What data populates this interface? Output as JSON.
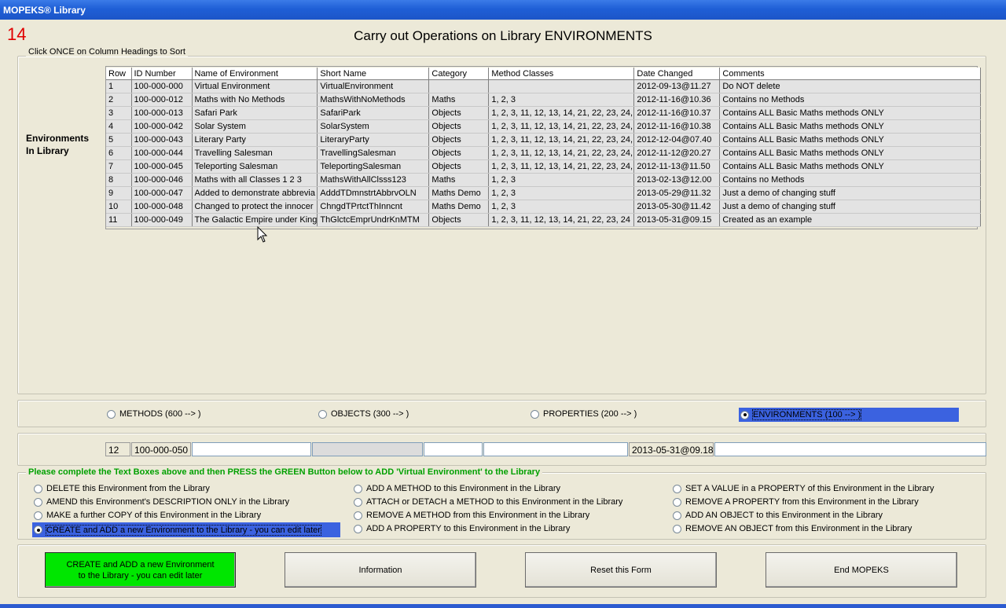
{
  "window": {
    "title": "MOPEKS® Library"
  },
  "page_number": "14",
  "heading": "Carry out Operations on Library ENVIRONMENTS",
  "table_group": {
    "legend": "Click ONCE on Column Headings to Sort",
    "side_label": [
      "Environments",
      "In Library"
    ]
  },
  "table": {
    "columns": [
      "Row",
      "ID Number",
      "Name of Environment",
      "Short Name",
      "Category",
      "Method Classes",
      "Date Changed",
      "Comments"
    ],
    "rows": [
      [
        "1",
        "100-000-000",
        "Virtual Environment",
        "VirtualEnvironment",
        "",
        "",
        "2012-09-13@11.27",
        "Do NOT delete"
      ],
      [
        "2",
        "100-000-012",
        "Maths with No Methods",
        "MathsWithNoMethods",
        "Maths",
        "1, 2, 3",
        "2012-11-16@10.36",
        "Contains no Methods"
      ],
      [
        "3",
        "100-000-013",
        "Safari Park",
        "SafariPark",
        "Objects",
        "1, 2, 3, 11, 12, 13, 14, 21, 22, 23, 24,",
        "2012-11-16@10.37",
        "Contains ALL Basic Maths methods ONLY"
      ],
      [
        "4",
        "100-000-042",
        "Solar System",
        "SolarSystem",
        "Objects",
        "1, 2, 3, 11, 12, 13, 14, 21, 22, 23, 24,",
        "2012-11-16@10.38",
        "Contains ALL Basic Maths methods ONLY"
      ],
      [
        "5",
        "100-000-043",
        "Literary Party",
        "LiteraryParty",
        "Objects",
        "1, 2, 3, 11, 12, 13, 14, 21, 22, 23, 24,",
        "2012-12-04@07.40",
        "Contains ALL Basic Maths methods ONLY"
      ],
      [
        "6",
        "100-000-044",
        "Travelling Salesman",
        "TravellingSalesman",
        "Objects",
        "1, 2, 3, 11, 12, 13, 14, 21, 22, 23, 24,",
        "2012-11-12@20.27",
        "Contains ALL Basic Maths methods ONLY"
      ],
      [
        "7",
        "100-000-045",
        "Teleporting Salesman",
        "TeleportingSalesman",
        "Objects",
        "1, 2, 3, 11, 12, 13, 14, 21, 22, 23, 24,",
        "2012-11-13@11.50",
        "Contains ALL Basic Maths methods ONLY"
      ],
      [
        "8",
        "100-000-046",
        "Maths with all Classes 1 2 3",
        "MathsWithAllClsss123",
        "Maths",
        "1, 2, 3",
        "2013-02-13@12.00",
        "Contains no Methods"
      ],
      [
        "9",
        "100-000-047",
        "Added to demonstrate abbrevia",
        "AdddTDmnstrtAbbrvOLN",
        "Maths Demo",
        "1, 2, 3",
        "2013-05-29@11.32",
        "Just a demo of changing stuff"
      ],
      [
        "10",
        "100-000-048",
        "Changed to protect the innocer",
        "ChngdTPrtctThInncnt",
        "Maths Demo",
        "1, 2, 3",
        "2013-05-30@11.42",
        "Just a demo of changing stuff"
      ],
      [
        "11",
        "100-000-049",
        "The Galactic Empire under King",
        "ThGlctcEmprUndrKnMTM",
        "Objects",
        "1, 2, 3, 11, 12, 13, 14, 21, 22, 23, 24",
        "2013-05-31@09.15",
        "Created as an example"
      ]
    ]
  },
  "library_types": [
    {
      "label": "METHODS (600 --> )",
      "selected": false
    },
    {
      "label": "OBJECTS (300 --> )",
      "selected": false
    },
    {
      "label": "PROPERTIES (200 --> )",
      "selected": false
    },
    {
      "label": "ENVIRONMENTS (100 --> )",
      "selected": true
    }
  ],
  "new_entry": {
    "row": "12",
    "id": "100-000-050",
    "name": "",
    "short_name": "",
    "category": "",
    "method_classes": "",
    "date": "2013-05-31@09.18",
    "comments": ""
  },
  "operations": {
    "legend": "Please complete the Text Boxes above and then PRESS the GREEN Button below to ADD 'Virtual Environment' to the Library",
    "options": [
      {
        "label": "DELETE this Environment from the Library",
        "selected": false
      },
      {
        "label": "AMEND this Environment's DESCRIPTION ONLY in the Library",
        "selected": false
      },
      {
        "label": "MAKE a further COPY of this Environment in the Library",
        "selected": false
      },
      {
        "label": "CREATE and ADD a new Environment to the Library - you can edit later",
        "selected": true
      },
      {
        "label": "ADD A METHOD to this Environment in the Library",
        "selected": false
      },
      {
        "label": "ATTACH or DETACH a METHOD to this Environment in the Library",
        "selected": false
      },
      {
        "label": "REMOVE A METHOD from this Environment in the Library",
        "selected": false
      },
      {
        "label": "ADD A PROPERTY to this Environment in the Library",
        "selected": false
      },
      {
        "label": "SET A VALUE in a PROPERTY of this Environment in the Library",
        "selected": false
      },
      {
        "label": "REMOVE A PROPERTY from this Environment in the Library",
        "selected": false
      },
      {
        "label": "ADD AN OBJECT to this Environment in the Library",
        "selected": false
      },
      {
        "label": "REMOVE  AN OBJECT from this Environment in the Library",
        "selected": false
      }
    ]
  },
  "buttons": {
    "create": [
      "CREATE and ADD a new Environment",
      "to the Library - you can edit later"
    ],
    "information": "Information",
    "reset": "Reset this Form",
    "end": "End MOPEKS"
  }
}
